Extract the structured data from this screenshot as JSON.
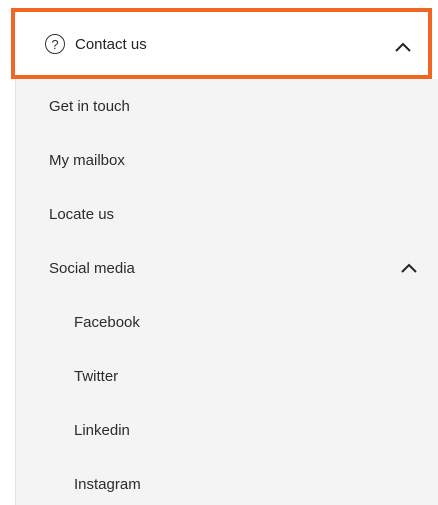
{
  "header": {
    "label": "Contact us",
    "icon": "help-circle-icon",
    "chevron_icon": "chevron-up-icon",
    "accent_color": "#f26522"
  },
  "menu": {
    "items": [
      {
        "label": "Get in touch"
      },
      {
        "label": "My mailbox"
      },
      {
        "label": "Locate us"
      },
      {
        "label": "Social media",
        "chevron_icon": "chevron-up-icon"
      }
    ],
    "social_items": [
      {
        "label": "Facebook"
      },
      {
        "label": "Twitter"
      },
      {
        "label": "Linkedin"
      },
      {
        "label": "Instagram"
      }
    ]
  }
}
